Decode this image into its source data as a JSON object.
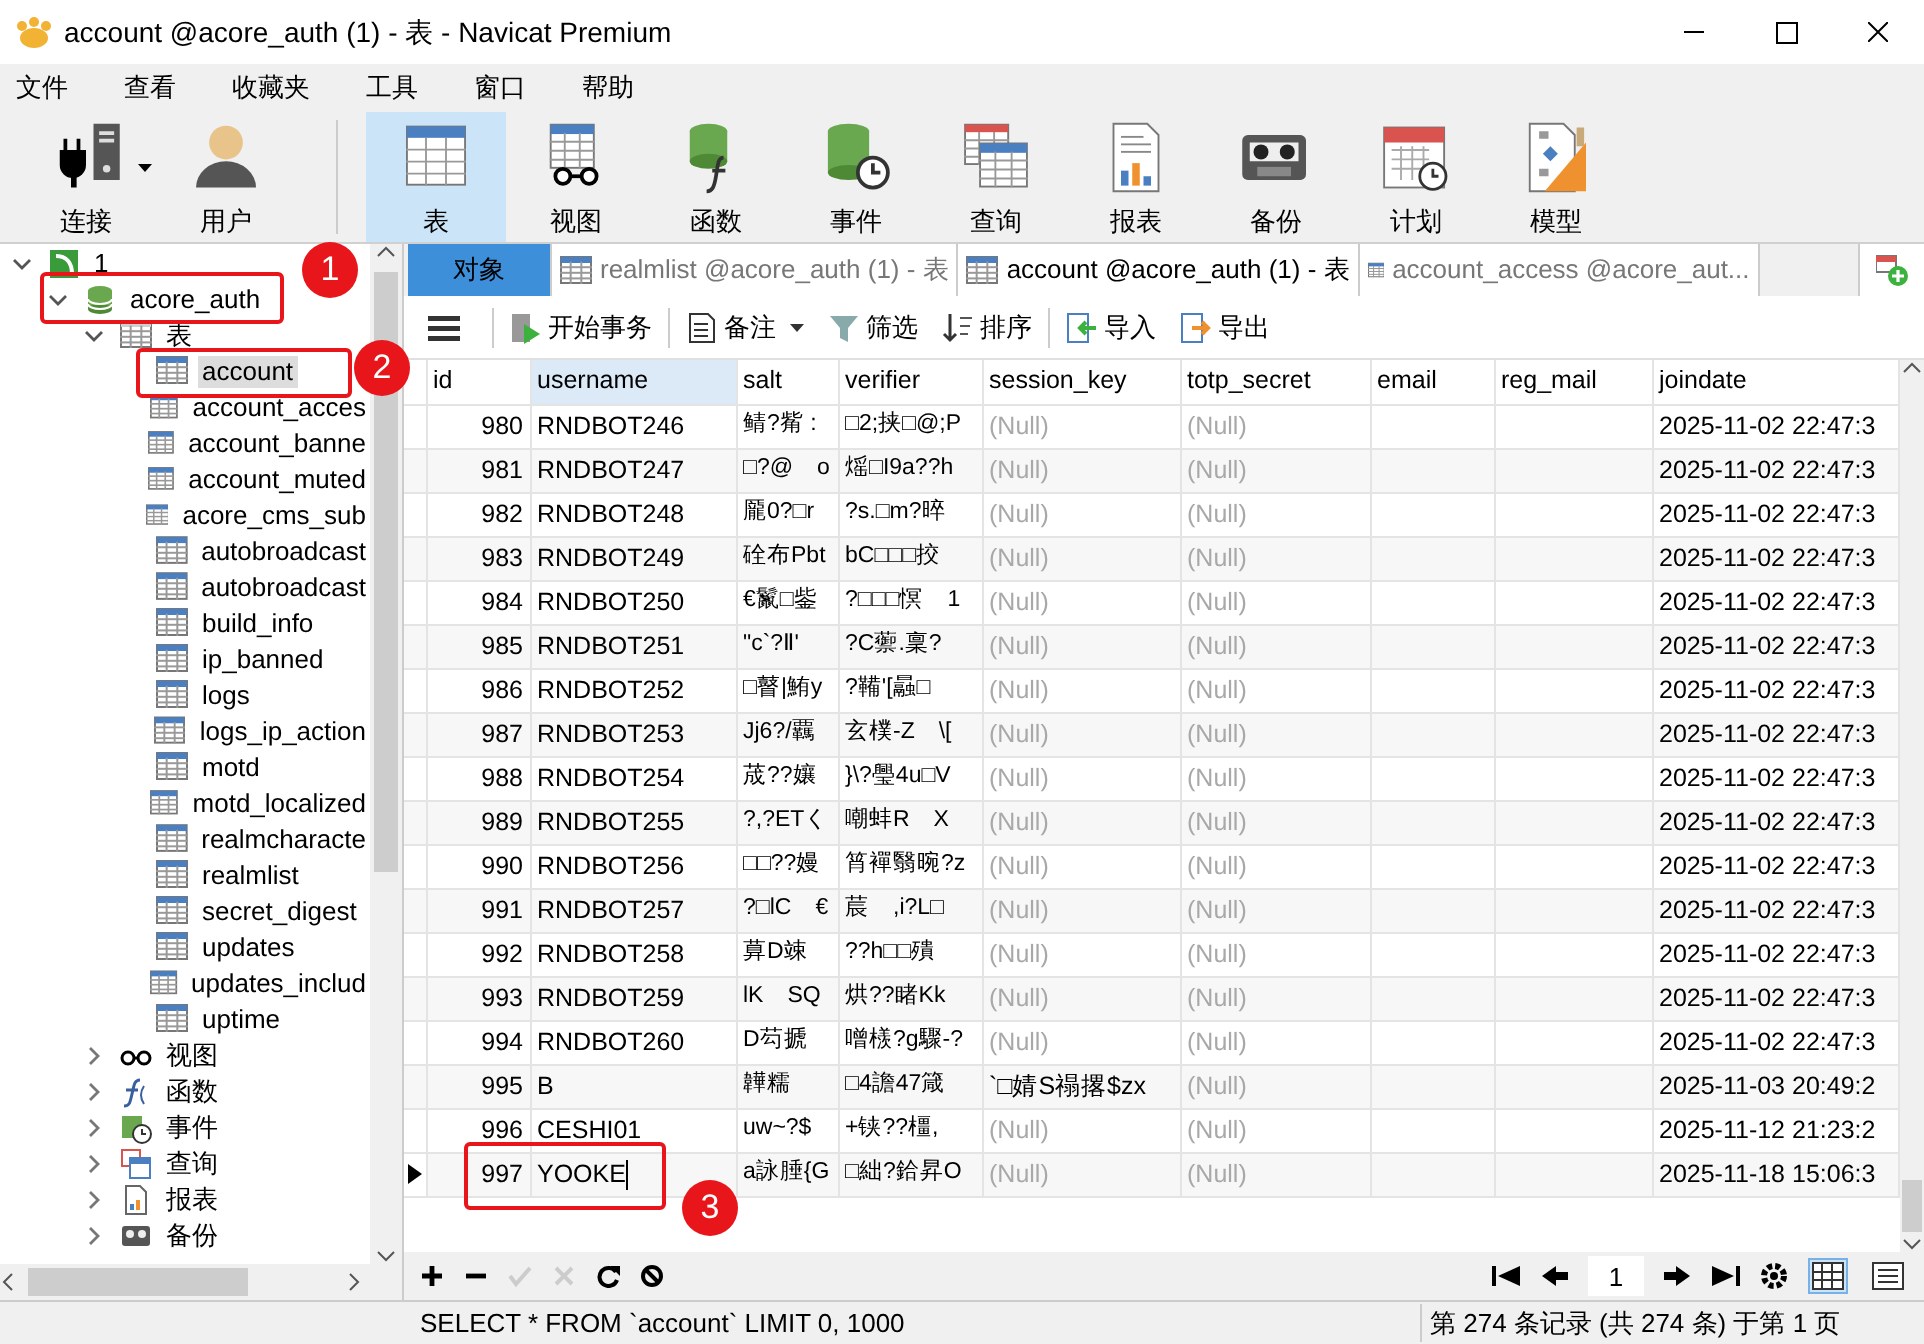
{
  "window": {
    "title": "account @acore_auth (1) - 表 - Navicat Premium"
  },
  "menu": [
    "文件",
    "查看",
    "收藏夹",
    "工具",
    "窗口",
    "帮助"
  ],
  "toolbar": [
    {
      "label": "连接",
      "selected": false,
      "dropdown": true
    },
    {
      "label": "用户",
      "selected": false,
      "dropdown": false
    },
    {
      "label": "表",
      "selected": true,
      "dropdown": false
    },
    {
      "label": "视图",
      "selected": false,
      "dropdown": false
    },
    {
      "label": "函数",
      "selected": false,
      "dropdown": false
    },
    {
      "label": "事件",
      "selected": false,
      "dropdown": false
    },
    {
      "label": "查询",
      "selected": false,
      "dropdown": false
    },
    {
      "label": "报表",
      "selected": false,
      "dropdown": false
    },
    {
      "label": "备份",
      "selected": false,
      "dropdown": false
    },
    {
      "label": "计划",
      "selected": false,
      "dropdown": false
    },
    {
      "label": "模型",
      "selected": false,
      "dropdown": false
    }
  ],
  "tree": [
    {
      "label": "1",
      "kind": "connection",
      "expanded": true,
      "selected": false,
      "children": [
        {
          "label": "acore_auth",
          "kind": "database",
          "expanded": true,
          "selected": false,
          "children": [
            {
              "label": "表",
              "kind": "tables",
              "expanded": true,
              "selected": false,
              "children": [
                {
                  "label": "account",
                  "kind": "table",
                  "selected": true
                },
                {
                  "label": "account_acces",
                  "kind": "table",
                  "selected": false
                },
                {
                  "label": "account_banne",
                  "kind": "table",
                  "selected": false
                },
                {
                  "label": "account_muted",
                  "kind": "table",
                  "selected": false
                },
                {
                  "label": "acore_cms_sub",
                  "kind": "table",
                  "selected": false
                },
                {
                  "label": "autobroadcast",
                  "kind": "table",
                  "selected": false
                },
                {
                  "label": "autobroadcast",
                  "kind": "table",
                  "selected": false
                },
                {
                  "label": "build_info",
                  "kind": "table",
                  "selected": false
                },
                {
                  "label": "ip_banned",
                  "kind": "table",
                  "selected": false
                },
                {
                  "label": "logs",
                  "kind": "table",
                  "selected": false
                },
                {
                  "label": "logs_ip_action",
                  "kind": "table",
                  "selected": false
                },
                {
                  "label": "motd",
                  "kind": "table",
                  "selected": false
                },
                {
                  "label": "motd_localized",
                  "kind": "table",
                  "selected": false
                },
                {
                  "label": "realmcharacte",
                  "kind": "table",
                  "selected": false
                },
                {
                  "label": "realmlist",
                  "kind": "table",
                  "selected": false
                },
                {
                  "label": "secret_digest",
                  "kind": "table",
                  "selected": false
                },
                {
                  "label": "updates",
                  "kind": "table",
                  "selected": false
                },
                {
                  "label": "updates_includ",
                  "kind": "table",
                  "selected": false
                },
                {
                  "label": "uptime",
                  "kind": "table",
                  "selected": false
                }
              ]
            },
            {
              "label": "视图",
              "kind": "views",
              "expanded": false,
              "selected": false
            },
            {
              "label": "函数",
              "kind": "functions",
              "expanded": false,
              "selected": false
            },
            {
              "label": "事件",
              "kind": "events",
              "expanded": false,
              "selected": false
            },
            {
              "label": "查询",
              "kind": "queries",
              "expanded": false,
              "selected": false
            },
            {
              "label": "报表",
              "kind": "reports",
              "expanded": false,
              "selected": false
            },
            {
              "label": "备份",
              "kind": "backups",
              "expanded": false,
              "selected": false
            }
          ]
        }
      ]
    }
  ],
  "tabs": [
    {
      "label": "对象",
      "kind": "objects",
      "selected": false
    },
    {
      "label": "realmlist @acore_auth (1) - 表",
      "kind": "table",
      "selected": false
    },
    {
      "label": "account @acore_auth (1) - 表",
      "kind": "table",
      "selected": true
    },
    {
      "label": "account_access @acore_aut...",
      "kind": "table",
      "selected": false
    }
  ],
  "data_toolbar": [
    {
      "label": "开始事务",
      "dropdown": false
    },
    {
      "label": "备注",
      "dropdown": true
    },
    {
      "label": "筛选",
      "dropdown": false
    },
    {
      "label": "排序",
      "dropdown": false
    },
    {
      "label": "导入",
      "dropdown": false
    },
    {
      "label": "导出",
      "dropdown": false
    }
  ],
  "table": {
    "columns": [
      {
        "label": "id",
        "selected": false
      },
      {
        "label": "username",
        "selected": true
      },
      {
        "label": "salt",
        "selected": false
      },
      {
        "label": "verifier",
        "selected": false
      },
      {
        "label": "session_key",
        "selected": false
      },
      {
        "label": "totp_secret",
        "selected": false
      },
      {
        "label": "email",
        "selected": false
      },
      {
        "label": "reg_mail",
        "selected": false
      },
      {
        "label": "joindate",
        "selected": false
      }
    ],
    "rows": [
      {
        "current": false,
        "cells": [
          "980",
          "RNDBOT246",
          "鲭?觜 :",
          "□2;挟□@;P",
          {
            "text": "(Null)",
            "null": true
          },
          {
            "text": "(Null)",
            "null": true
          },
          null,
          null,
          "2025-11-02 22:47:3"
        ]
      },
      {
        "current": false,
        "cells": [
          "981",
          "RNDBOT247",
          "□?@　o",
          "熎□I9a??h",
          {
            "text": "(Null)",
            "null": true
          },
          {
            "text": "(Null)",
            "null": true
          },
          null,
          null,
          "2025-11-02 22:47:3"
        ]
      },
      {
        "current": false,
        "cells": [
          "982",
          "RNDBOT248",
          "龎0?□r",
          "?s.□m?晬",
          {
            "text": "(Null)",
            "null": true
          },
          {
            "text": "(Null)",
            "null": true
          },
          null,
          null,
          "2025-11-02 22:47:3"
        ]
      },
      {
        "current": false,
        "cells": [
          "983",
          "RNDBOT249",
          "硂布Pbt",
          "bC□□□挍",
          {
            "text": "(Null)",
            "null": true
          },
          {
            "text": "(Null)",
            "null": true
          },
          null,
          null,
          "2025-11-02 22:47:3"
        ]
      },
      {
        "current": false,
        "cells": [
          "984",
          "RNDBOT250",
          "€鬣□鈭",
          "?□□□慏　1",
          {
            "text": "(Null)",
            "null": true
          },
          {
            "text": "(Null)",
            "null": true
          },
          null,
          null,
          "2025-11-02 22:47:3"
        ]
      },
      {
        "current": false,
        "cells": [
          "985",
          "RNDBOT251",
          "\"c`?Ⅱ'",
          "?C蘌.稟?",
          {
            "text": "(Null)",
            "null": true
          },
          {
            "text": "(Null)",
            "null": true
          },
          null,
          null,
          "2025-11-02 22:47:3"
        ]
      },
      {
        "current": false,
        "cells": [
          "986",
          "RNDBOT252",
          "□瞽|鮪y",
          "?鞴'[曧□",
          {
            "text": "(Null)",
            "null": true
          },
          {
            "text": "(Null)",
            "null": true
          },
          null,
          null,
          "2025-11-02 22:47:3"
        ]
      },
      {
        "current": false,
        "cells": [
          "987",
          "RNDBOT253",
          "Jj6?/覊",
          "玄樸-Z　\\[",
          {
            "text": "(Null)",
            "null": true
          },
          {
            "text": "(Null)",
            "null": true
          },
          null,
          null,
          "2025-11-02 22:47:3"
        ]
      },
      {
        "current": false,
        "cells": [
          "988",
          "RNDBOT254",
          "荿??孃",
          "}\\?璺4u□V",
          {
            "text": "(Null)",
            "null": true
          },
          {
            "text": "(Null)",
            "null": true
          },
          null,
          null,
          "2025-11-02 22:47:3"
        ]
      },
      {
        "current": false,
        "cells": [
          "989",
          "RNDBOT255",
          "?,?ETく",
          "嘲蚌R　X",
          {
            "text": "(Null)",
            "null": true
          },
          {
            "text": "(Null)",
            "null": true
          },
          null,
          null,
          "2025-11-02 22:47:3"
        ]
      },
      {
        "current": false,
        "cells": [
          "990",
          "RNDBOT256",
          "□□??嫚",
          "筲襌翳晼?z",
          {
            "text": "(Null)",
            "null": true
          },
          {
            "text": "(Null)",
            "null": true
          },
          null,
          null,
          "2025-11-02 22:47:3"
        ]
      },
      {
        "current": false,
        "cells": [
          "991",
          "RNDBOT257",
          "?□lC　€",
          "莀　,i?L□",
          {
            "text": "(Null)",
            "null": true
          },
          {
            "text": "(Null)",
            "null": true
          },
          null,
          null,
          "2025-11-02 22:47:3"
        ]
      },
      {
        "current": false,
        "cells": [
          "992",
          "RNDBOT258",
          "萛D竦",
          "??h□□殨",
          {
            "text": "(Null)",
            "null": true
          },
          {
            "text": "(Null)",
            "null": true
          },
          null,
          null,
          "2025-11-02 22:47:3"
        ]
      },
      {
        "current": false,
        "cells": [
          "993",
          "RNDBOT259",
          "lK　SQ",
          "烘??睹Kk",
          {
            "text": "(Null)",
            "null": true
          },
          {
            "text": "(Null)",
            "null": true
          },
          null,
          null,
          "2025-11-02 22:47:3"
        ]
      },
      {
        "current": false,
        "cells": [
          "994",
          "RNDBOT260",
          "D芶搋",
          "噌檨?g驟-?",
          {
            "text": "(Null)",
            "null": true
          },
          {
            "text": "(Null)",
            "null": true
          },
          null,
          null,
          "2025-11-02 22:47:3"
        ]
      },
      {
        "current": false,
        "cells": [
          "995",
          "B",
          "韡糯",
          "□4譫47箴",
          "`□婧S禢撂$zx",
          {
            "text": "(Null)",
            "null": true
          },
          null,
          null,
          "2025-11-03 20:49:2"
        ]
      },
      {
        "current": false,
        "cells": [
          "996",
          "CESHI01",
          "uw~?$",
          "+铗??橿,",
          {
            "text": "(Null)",
            "null": true
          },
          {
            "text": "(Null)",
            "null": true
          },
          null,
          null,
          "2025-11-12 21:23:2"
        ]
      },
      {
        "current": true,
        "cells": [
          "997",
          "YOOKE",
          "a詠腄{G",
          "□絀?鉿昇O",
          {
            "text": "(Null)",
            "null": true
          },
          {
            "text": "(Null)",
            "null": true
          },
          null,
          null,
          "2025-11-18 15:06:3"
        ]
      }
    ]
  },
  "pager": {
    "page": "1"
  },
  "view_modes": [
    {
      "kind": "grid",
      "selected": true
    },
    {
      "kind": "form",
      "selected": false
    }
  ],
  "status_bar": {
    "query": "SELECT * FROM `account` LIMIT 0, 1000",
    "records": "第 274 条记录 (共 274 条) 于第 1 页"
  },
  "annotations": [
    {
      "number": "1"
    },
    {
      "number": "2"
    },
    {
      "number": "3"
    }
  ]
}
